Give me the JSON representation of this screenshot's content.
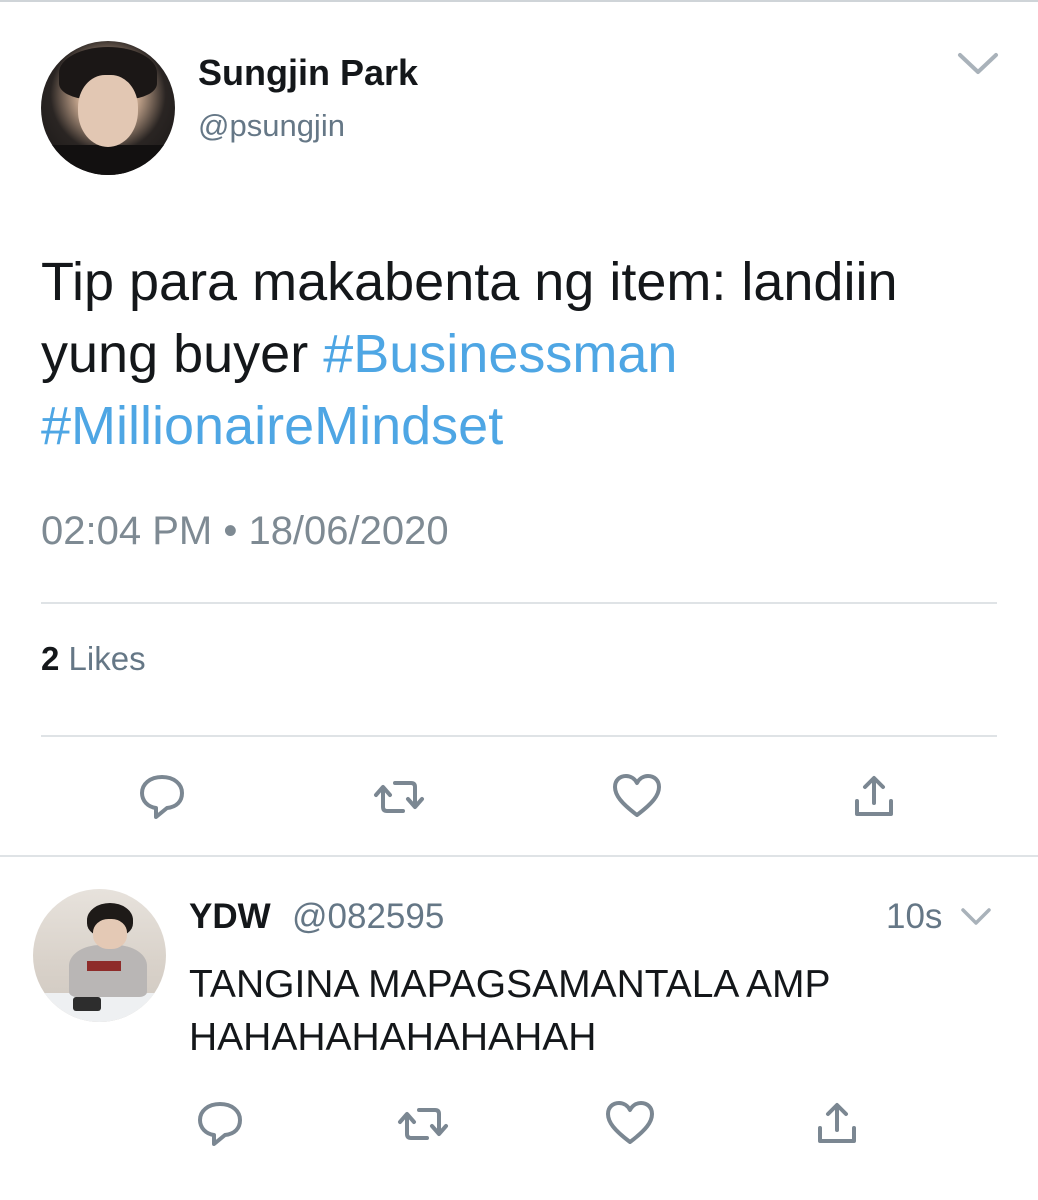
{
  "tweet": {
    "author_name": "Sungjin Park",
    "author_handle": "@psungjin",
    "text_plain": "Tip para makabenta ng item: landiin yung buyer",
    "hashtag_1": "#Businessman",
    "hashtag_2": "#MillionaireMindset",
    "timestamp": "02:04 PM • 18/06/2020",
    "likes_count": "2",
    "likes_label": "Likes"
  },
  "reply": {
    "author_name": "YDW",
    "author_handle": "@082595",
    "time": "10s",
    "text_line1": "TANGINA MAPAGSAMANTALA AMP",
    "text_line2": "HAHAHAHAHAHAHAH"
  },
  "icons": {
    "reply": "reply-icon",
    "retweet": "retweet-icon",
    "like": "heart-icon",
    "share": "share-icon",
    "menu": "chevron-down-icon"
  },
  "colors": {
    "hashtag": "#4ea6e4",
    "secondary_text": "#657786",
    "icon_gray": "#7b8792",
    "divider": "#dfe3e6"
  }
}
